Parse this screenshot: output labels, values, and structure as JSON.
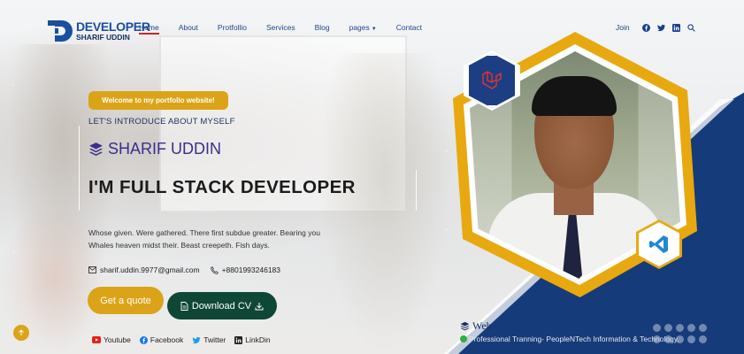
{
  "header": {
    "logo_title": "DEVELOPER",
    "logo_subtitle": "SHARIF UDDIN",
    "nav": [
      {
        "label": "Home",
        "active": true
      },
      {
        "label": "About"
      },
      {
        "label": "Protfollio"
      },
      {
        "label": "Services"
      },
      {
        "label": "Blog"
      },
      {
        "label": "pages",
        "has_dropdown": true
      },
      {
        "label": "Contact"
      }
    ],
    "join_label": "Join",
    "social_icons": [
      "facebook-icon",
      "twitter-icon",
      "linkedin-icon",
      "search-icon"
    ]
  },
  "hero": {
    "welcome_badge": "Welcome to my portfolio website!",
    "intro": "LET'S INTRODUCE ABOUT MYSELF",
    "name": "SHARIF UDDIN",
    "headline": "I'M FULL STACK DEVELOPER",
    "description": "Whose given. Were gathered. There first subdue greater. Bearing you Whales heaven midst their. Beast creepeth. Fish days.",
    "email": "sharif.uddin.9977@gmail.com",
    "phone": "+8801993246183",
    "quote_button": "Get a quote",
    "cv_button": "Download CV",
    "socials": [
      "Youtube",
      "Facebook",
      "Twitter",
      "LinkDin"
    ]
  },
  "side": {
    "web_label": "Web",
    "training_text": "Professional Tranning- PeopleNTech Information & Technology."
  },
  "colors": {
    "accent": "#dba418",
    "primary_blue": "#163b7a",
    "cv_green": "#0f4737",
    "nav_active_underline": "#c9252c"
  }
}
